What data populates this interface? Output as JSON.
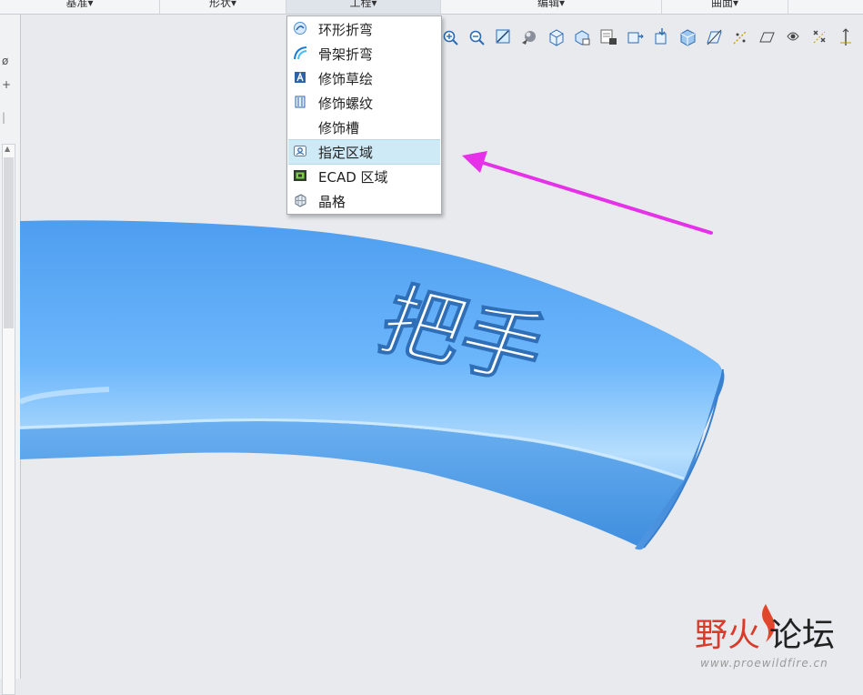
{
  "ribbon": {
    "tabs": [
      {
        "label": "基准"
      },
      {
        "label": "形状"
      },
      {
        "label": "工程"
      },
      {
        "label": "编辑"
      },
      {
        "label": "曲面"
      }
    ]
  },
  "menu": {
    "items": [
      {
        "label": "环形折弯",
        "icon": "toroidal-bend-icon"
      },
      {
        "label": "骨架折弯",
        "icon": "spinal-bend-icon"
      },
      {
        "label": "修饰草绘",
        "icon": "cosmetic-sketch-icon"
      },
      {
        "label": "修饰螺纹",
        "icon": "cosmetic-thread-icon"
      },
      {
        "label": "修饰槽",
        "icon": ""
      },
      {
        "label": "指定区域",
        "icon": "designate-area-icon",
        "highlighted": true
      },
      {
        "label": "ECAD 区域",
        "icon": "ecad-area-icon"
      },
      {
        "label": "晶格",
        "icon": "lattice-icon"
      }
    ]
  },
  "model": {
    "embossed_text": "把手",
    "body_color": "#5aa6f0",
    "highlight_color": "#bfe2ff"
  },
  "annotation": {
    "arrow_color": "#e532e8"
  },
  "watermark": {
    "brand": "野火论坛",
    "domain": "www.proewildfire.cn",
    "brand_color_red": "#d93b2a",
    "brand_color_dark": "#222222"
  }
}
